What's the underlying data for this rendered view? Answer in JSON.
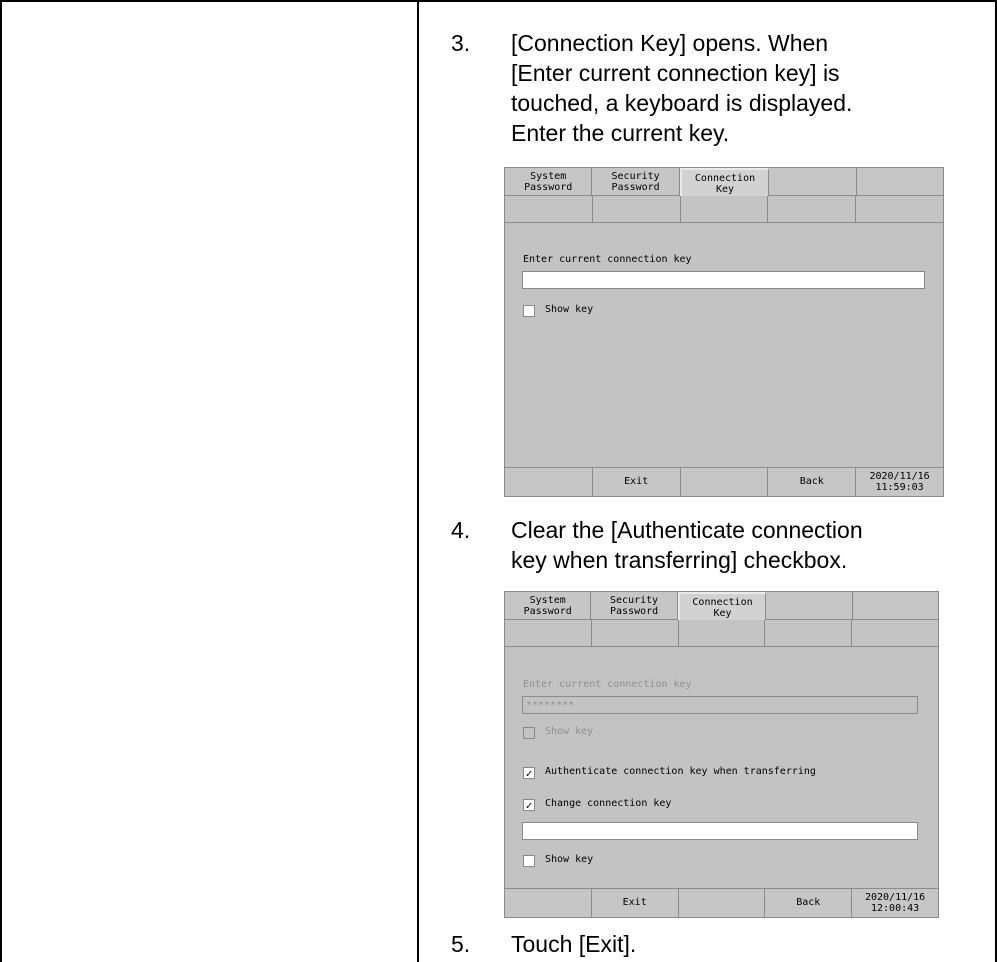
{
  "steps": [
    {
      "num": "3.",
      "lines": [
        "[Connection Key] opens. When",
        "[Enter current connection key] is",
        "touched, a keyboard is displayed.",
        "Enter the current key."
      ]
    },
    {
      "num": "4.",
      "lines": [
        "Clear the [Authenticate connection",
        "key when transferring] checkbox."
      ]
    },
    {
      "num": "5.",
      "lines": [
        "Touch [Exit]."
      ]
    }
  ],
  "screen1": {
    "tabs": [
      "System\nPassword",
      "Security\nPassword",
      "Connection\nKey",
      "",
      ""
    ],
    "field_label": "Enter current connection key",
    "field_value": "",
    "show_key": "Show key",
    "footer": [
      "",
      "Exit",
      "",
      "Back",
      "2020/11/16\n11:59:03"
    ]
  },
  "screen2": {
    "tabs": [
      "System\nPassword",
      "Security\nPassword",
      "Connection\nKey",
      "",
      ""
    ],
    "field_label": "Enter current connection key",
    "field_value": "********",
    "show_key": "Show key",
    "auth_label": "Authenticate connection key when transferring",
    "change_label": "Change connection key",
    "new_key_value": "",
    "show_key2": "Show key",
    "check_mark": "✓",
    "footer": [
      "",
      "Exit",
      "",
      "Back",
      "2020/11/16\n12:00:43"
    ]
  }
}
